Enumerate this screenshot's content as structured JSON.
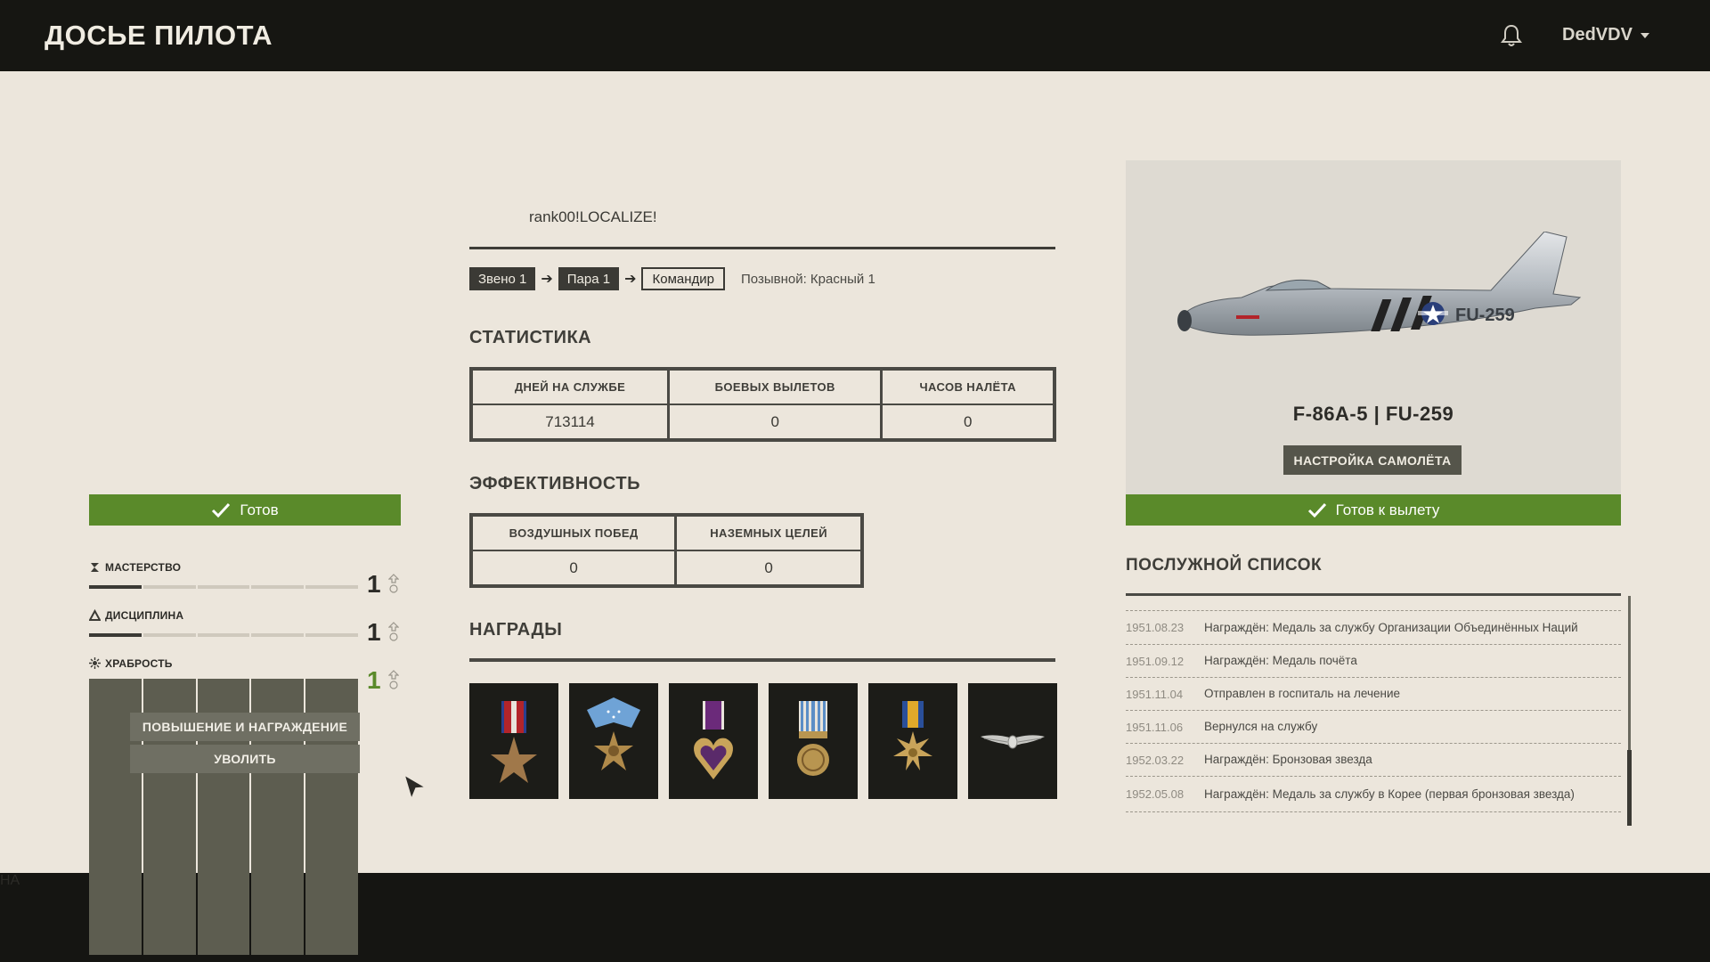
{
  "header": {
    "title": "ДОСЬЕ ПИЛОТА",
    "username": "DedVDV",
    "bell_icon": "bell-icon",
    "caret_icon": "chevron-down-icon"
  },
  "left": {
    "ready_label": "Готов",
    "skills": [
      {
        "name": "МАСТЕРСТВО",
        "level": "1",
        "icon": "mastery-icon",
        "segments_filled": 1,
        "segments_total": 5
      },
      {
        "name": "ДИСЦИПЛИНА",
        "level": "1",
        "icon": "discipline-icon",
        "segments_filled": 1,
        "segments_total": 5
      },
      {
        "name": "ХРАБРОСТЬ",
        "level": "1",
        "icon": "bravery-icon",
        "segments_filled": 0,
        "segments_total": 5
      }
    ],
    "context_menu": {
      "promote": "ПОВЫШЕНИЕ И НАГРАЖДЕНИЕ",
      "dismiss": "УВОЛИТЬ"
    }
  },
  "middle": {
    "rank": "rank00!LOCALIZE!",
    "chain": {
      "flight": "Звено 1",
      "pair": "Пара 1",
      "role": "Командир",
      "callsign": "Позывной: Красный 1"
    },
    "stats_title": "СТАТИСТИКА",
    "stats": {
      "headers": [
        "ДНЕЙ НА СЛУЖБЕ",
        "БОЕВЫХ ВЫЛЕТОВ",
        "ЧАСОВ НАЛЁТА"
      ],
      "values": [
        "713114",
        "0",
        "0"
      ]
    },
    "eff_title": "ЭФФЕКТИВНОСТЬ",
    "efficiency": {
      "headers": [
        "ВОЗДУШНЫХ ПОБЕД",
        "НАЗЕМНЫХ ЦЕЛЕЙ"
      ],
      "values": [
        "0",
        "0"
      ]
    },
    "awards_title": "НАГРАДЫ",
    "medals": [
      "bronze-star-medal-icon",
      "medal-of-honor-icon",
      "purple-heart-medal-icon",
      "un-service-medal-icon",
      "air-medal-icon",
      "pilot-wings-badge-icon"
    ]
  },
  "right": {
    "plane_name": "F-86A-5 | FU-259",
    "tail_code": "FU-259",
    "setup_label": "НАСТРОЙКА САМОЛЁТА",
    "fly_label": "Готов к вылету",
    "record_title": "ПОСЛУЖНОЙ СПИСОК",
    "record": [
      {
        "date": "1951.08.23",
        "text": "Награждён: Медаль за службу Организации Объединённых Наций"
      },
      {
        "date": "1951.09.12",
        "text": "Награждён: Медаль почёта"
      },
      {
        "date": "1951.11.04",
        "text": "Отправлен в госпиталь на лечение"
      },
      {
        "date": "1951.11.06",
        "text": "Вернулся на службу"
      },
      {
        "date": "1952.03.22",
        "text": "Награждён: Бронзовая звезда"
      },
      {
        "date": "1952.05.08",
        "text": "Награждён: Медаль за службу в Корее (первая бронзовая звезда)"
      }
    ]
  },
  "bottom": {
    "label": "НА"
  },
  "colors": {
    "ready_green": "#5a8a2a",
    "topbar": "#161612",
    "page_bg": "#ece6dc"
  }
}
